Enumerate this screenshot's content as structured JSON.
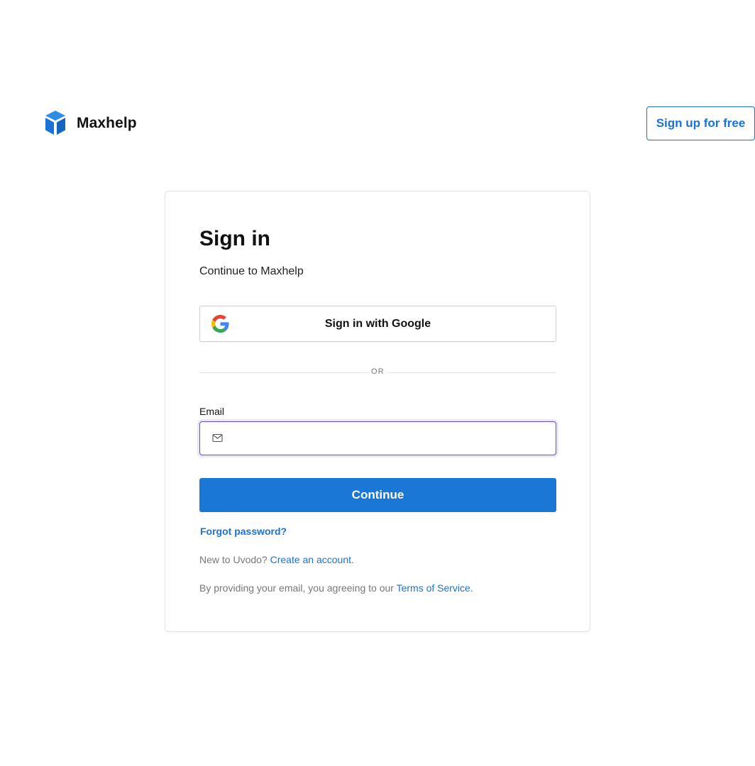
{
  "brand": {
    "name": "Maxhelp",
    "logo_icon": "blue-cube-icon",
    "color": "#1a73d4"
  },
  "header": {
    "signup_label": "Sign up for free"
  },
  "signin": {
    "title": "Sign in",
    "subtitle": "Continue to Maxhelp",
    "google_label": "Sign in with Google",
    "divider_text": "OR",
    "email_label": "Email",
    "email_value": "",
    "email_placeholder": "",
    "continue_label": "Continue",
    "forgot_label": "Forgot password?",
    "new_prefix": "New to Uvodo?",
    "create_account_label": "Create an account.",
    "terms_prefix": "By providing your email, you agreeing to our",
    "terms_link": "Terms of Service."
  },
  "colors": {
    "accent": "#1a77d6",
    "focus_border": "#6a4ad6",
    "muted_text": "#777777"
  }
}
